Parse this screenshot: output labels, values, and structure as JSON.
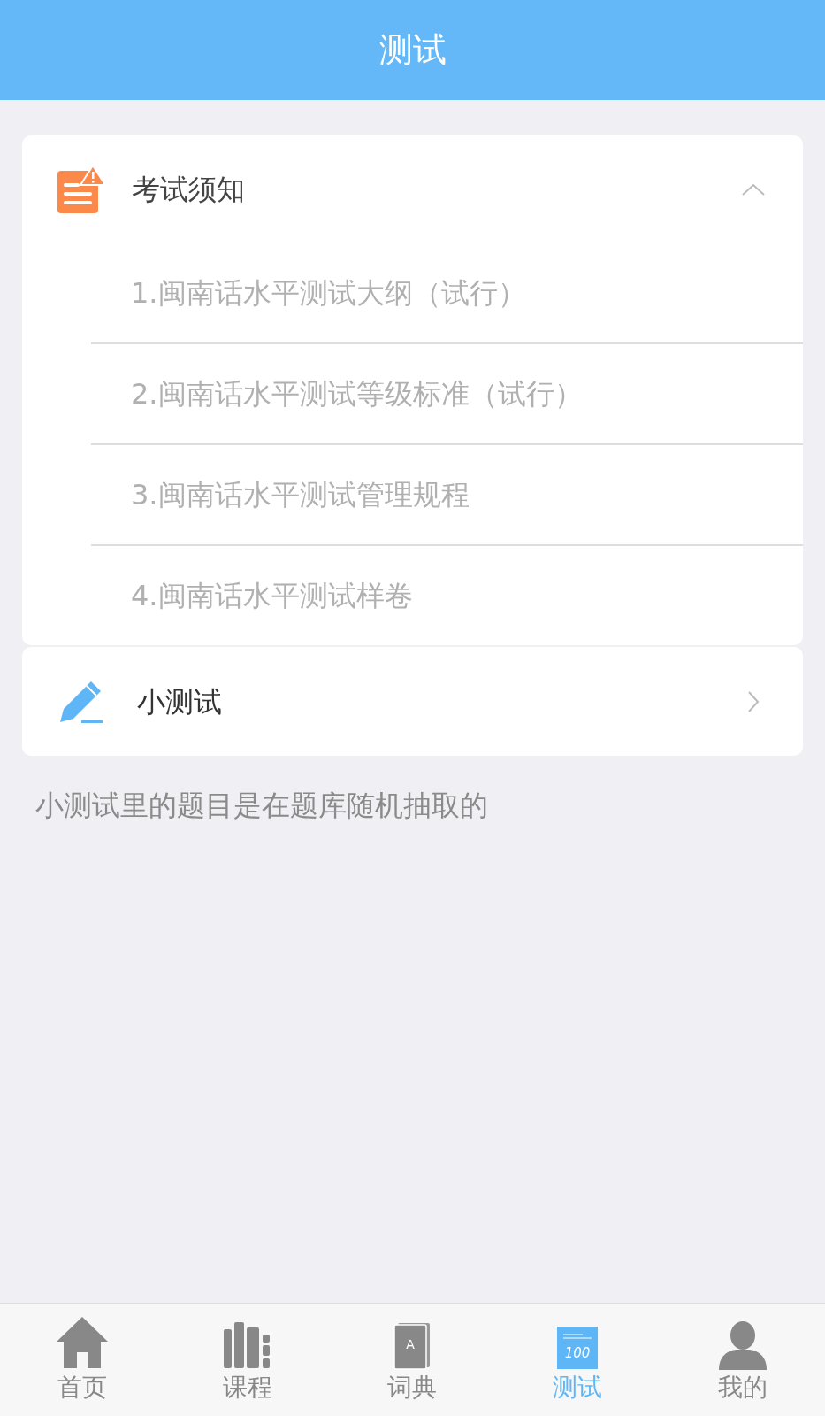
{
  "header": {
    "title": "测试"
  },
  "notice": {
    "title": "考试须知",
    "expanded": true,
    "items": [
      {
        "label": "1.闽南话水平测试大纲（试行）"
      },
      {
        "label": "2.闽南话水平测试等级标准（试行）"
      },
      {
        "label": "3.闽南话水平测试管理规程"
      },
      {
        "label": "4.闽南话水平测试样卷"
      }
    ]
  },
  "quiz": {
    "title": "小测试"
  },
  "hint": "小测试里的题目是在题库随机抽取的",
  "tabs": [
    {
      "kind": "home",
      "label": "首页",
      "selected": false
    },
    {
      "kind": "course",
      "label": "课程",
      "selected": false
    },
    {
      "kind": "dictionary",
      "label": "词典",
      "icon_text": "A",
      "selected": false
    },
    {
      "kind": "test",
      "label": "测试",
      "icon_text": "100",
      "selected": true
    },
    {
      "kind": "profile",
      "label": "我的",
      "selected": false
    }
  ]
}
